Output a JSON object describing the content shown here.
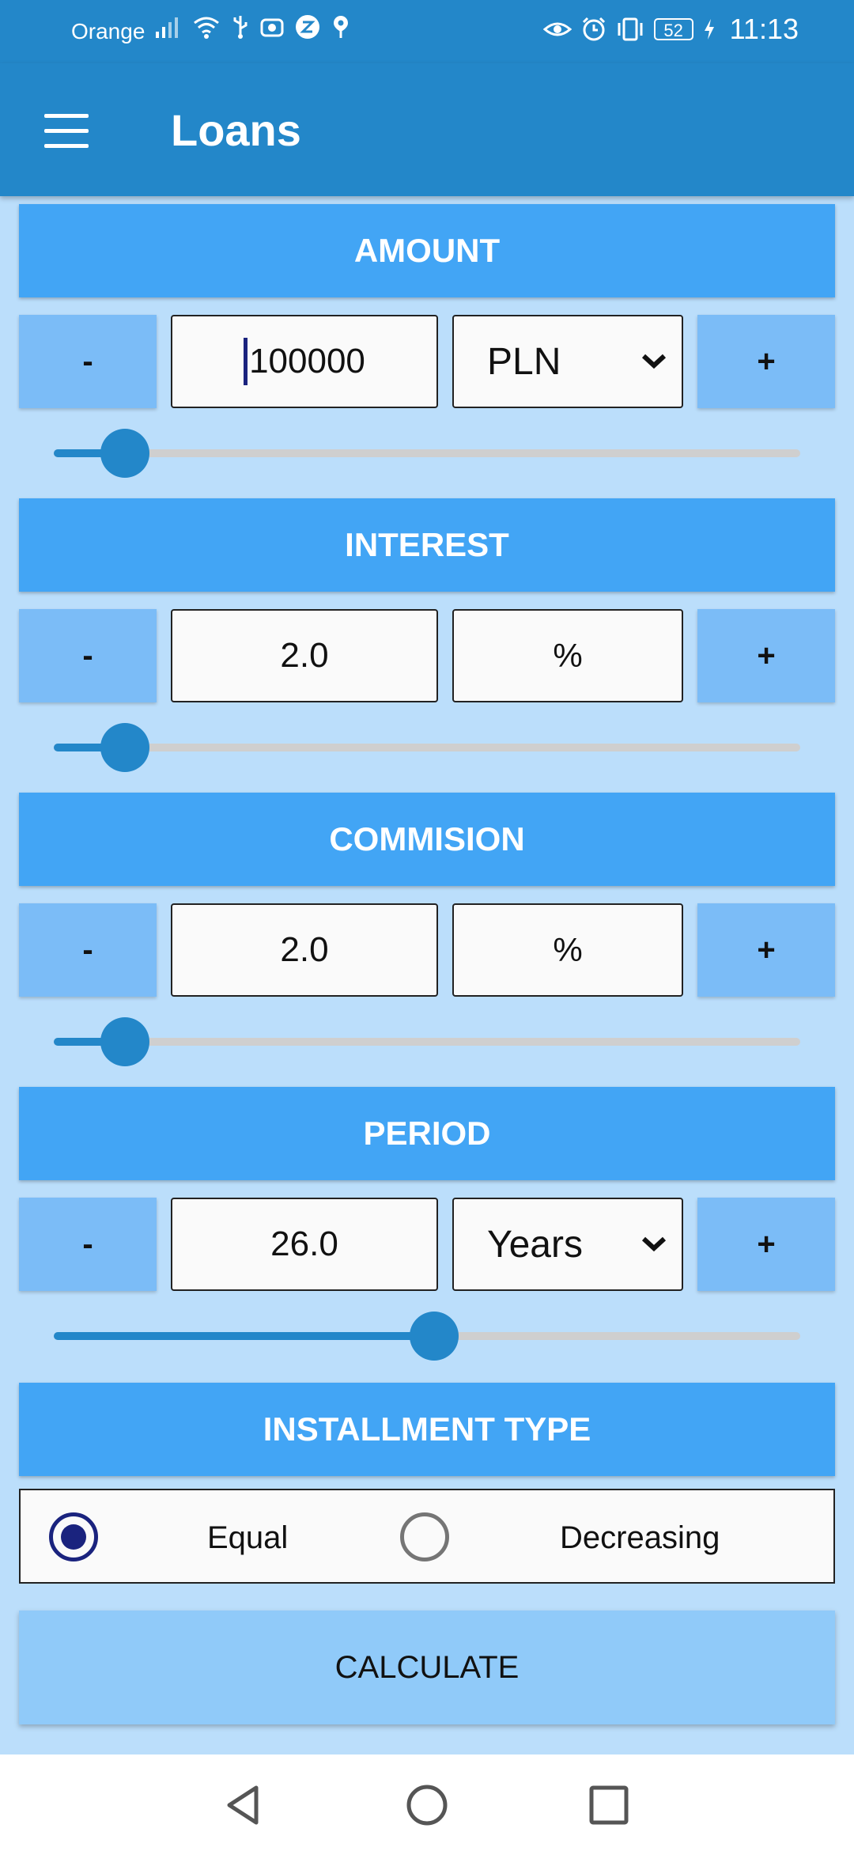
{
  "status_bar": {
    "carrier": "Orange",
    "battery": "52",
    "time": "11:13"
  },
  "app_bar": {
    "title": "Loans",
    "menu_icon": "menu-icon"
  },
  "amount": {
    "header": "AMOUNT",
    "minus_label": "-",
    "plus_label": "+",
    "value": "100000",
    "currency": "PLN",
    "slider_fraction": 0.095
  },
  "interest": {
    "header": "INTEREST",
    "minus_label": "-",
    "plus_label": "+",
    "value": "2.0",
    "unit": "%",
    "slider_fraction": 0.095
  },
  "commission": {
    "header": "COMMISION",
    "minus_label": "-",
    "plus_label": "+",
    "value": "2.0",
    "unit": "%",
    "slider_fraction": 0.095
  },
  "period": {
    "header": "PERIOD",
    "minus_label": "-",
    "plus_label": "+",
    "value": "26.0",
    "unit": "Years",
    "slider_fraction": 0.51
  },
  "installment": {
    "header": "INSTALLMENT TYPE",
    "options": [
      {
        "label": "Equal",
        "selected": true
      },
      {
        "label": "Decreasing",
        "selected": false
      }
    ]
  },
  "calculate_label": "CALCULATE",
  "colors": {
    "primary": "#2387c9",
    "header": "#42a5f5",
    "background": "#bbdefb",
    "button": "#7bbcf7",
    "calculate": "#90caf9",
    "radio_selected": "#1a237e"
  },
  "nav": {
    "back_icon": "back-icon",
    "home_icon": "home-icon",
    "recents_icon": "recents-icon"
  }
}
